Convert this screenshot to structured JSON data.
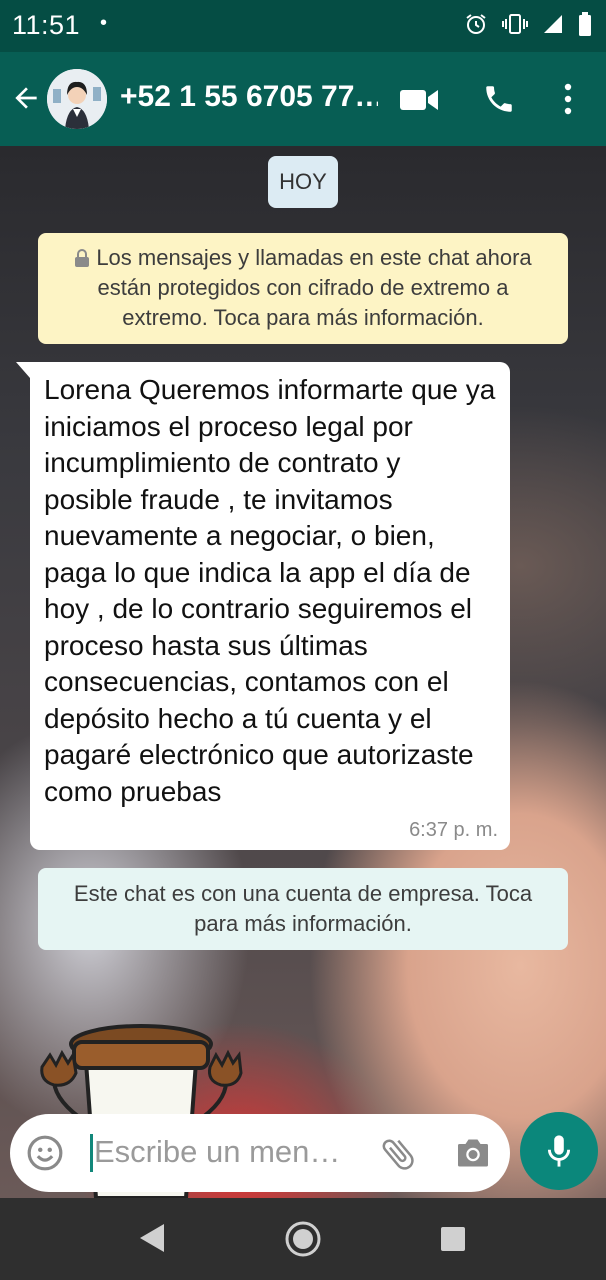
{
  "status_bar": {
    "time": "11:51",
    "dot": "•",
    "icons": [
      "alarm-icon",
      "vibrate-icon",
      "signal-icon",
      "battery-icon"
    ]
  },
  "header": {
    "contact_name": "+52 1 55 6705 77…",
    "icons": [
      "back-arrow-icon",
      "video-call-icon",
      "phone-call-icon",
      "more-vert-icon"
    ]
  },
  "chat": {
    "date_chip": "HOY",
    "encryption_notice": "Los mensajes y llamadas en este chat ahora están protegidos con cifrado de extremo a extremo. Toca para más información.",
    "messages": [
      {
        "direction": "incoming",
        "text": "Lorena Queremos informarte que ya iniciamos el proceso legal por incumplimiento de contrato y posible fraude , te invitamos nuevamente a negociar, o bien, paga lo que indica la app el día de hoy , de lo contrario seguiremos el proceso hasta sus últimas consecuencias, contamos con el depósito hecho a tú cuenta y el pagaré electrónico que autorizaste como pruebas",
        "time": "6:37 p. m."
      }
    ],
    "business_notice": "Este chat es con una cuenta de empresa. Toca para más información.",
    "sticker": "coffee-cup-waving-sticker"
  },
  "composer": {
    "placeholder": "Escribe un men…",
    "icons": [
      "emoji-icon",
      "attach-icon",
      "camera-icon",
      "mic-icon"
    ]
  },
  "colors": {
    "status_bar": "#054d44",
    "app_bar": "#075e54",
    "accent": "#0b877b",
    "notice_yellow": "#fdf4c5",
    "notice_teal": "#e6f5f3"
  }
}
